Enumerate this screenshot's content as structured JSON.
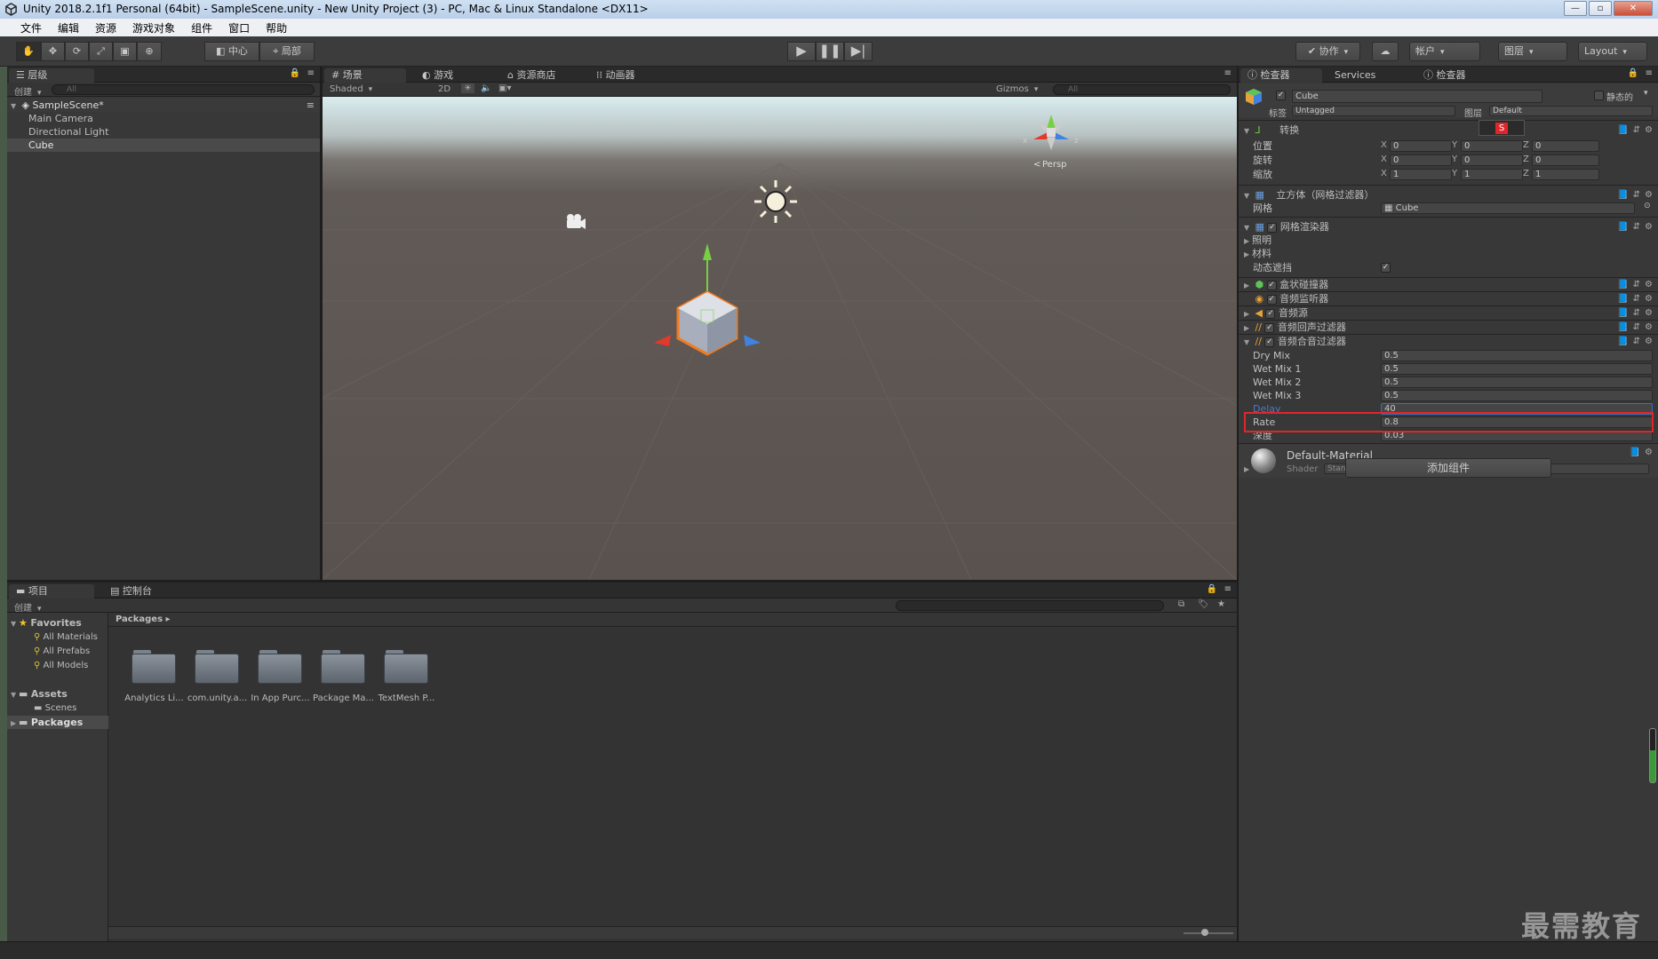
{
  "window": {
    "title": "Unity 2018.2.1f1 Personal (64bit) - SampleScene.unity - New Unity Project (3) - PC, Mac & Linux Standalone <DX11>"
  },
  "menu": [
    "文件",
    "编辑",
    "资源",
    "游戏对象",
    "组件",
    "窗口",
    "帮助"
  ],
  "toolbar": {
    "pivot": "中心",
    "space": "局部",
    "collab": "协作",
    "account": "帐户",
    "layers": "图层",
    "layout": "Layout"
  },
  "hierarchy": {
    "tab": "层级",
    "create": "创建",
    "search_placeholder": "All",
    "scene": "SampleScene*",
    "items": [
      "Main Camera",
      "Directional Light",
      "Cube"
    ]
  },
  "scene": {
    "tabs": [
      "场景",
      "游戏",
      "资源商店",
      "动画器"
    ],
    "shading": "Shaded",
    "mode2d": "2D",
    "gizmos": "Gizmos",
    "search_placeholder": "All",
    "persp": "Persp",
    "gizmo_x": "x",
    "gizmo_z": "z"
  },
  "project": {
    "tabs": [
      "项目",
      "控制台"
    ],
    "create": "创建",
    "favorites": "Favorites",
    "fav_items": [
      "All Materials",
      "All Prefabs",
      "All Models"
    ],
    "assets": "Assets",
    "scenes": "Scenes",
    "packages": "Packages",
    "breadcrumb": "Packages",
    "folders": [
      "Analytics Li...",
      "com.unity.a...",
      "In App Purc...",
      "Package Ma...",
      "TextMesh P..."
    ]
  },
  "inspector": {
    "tabs": [
      "检查器",
      "Services",
      "检查器"
    ],
    "object_name": "Cube",
    "static_label": "静态的",
    "tag_label": "标签",
    "tag_value": "Untagged",
    "layer_label": "图层",
    "layer_value": "Default",
    "transform": {
      "title": "转换",
      "rows": [
        {
          "label": "位置",
          "x": "0",
          "y": "0",
          "z": "0"
        },
        {
          "label": "旋转",
          "x": "0",
          "y": "0",
          "z": "0"
        },
        {
          "label": "缩放",
          "x": "1",
          "y": "1",
          "z": "1"
        }
      ]
    },
    "mesh_filter": {
      "title": "立方体（网格过滤器）",
      "mesh_label": "网格",
      "mesh_value": "Cube"
    },
    "mesh_renderer": {
      "title": "网格渲染器",
      "lighting": "照明",
      "materials": "材料",
      "dynamic_occlusion": "动态遮挡"
    },
    "components": [
      "盒状碰撞器",
      "音频监听器",
      "音频源",
      "音频回声过滤器",
      "音频合音过滤器"
    ],
    "chorus": {
      "rows": [
        {
          "label": "Dry Mix",
          "value": "0.5"
        },
        {
          "label": "Wet Mix 1",
          "value": "0.5"
        },
        {
          "label": "Wet Mix 2",
          "value": "0.5"
        },
        {
          "label": "Wet Mix 3",
          "value": "0.5"
        },
        {
          "label": "Delay",
          "value": "40"
        },
        {
          "label": "Rate",
          "value": "0.8"
        },
        {
          "label": "深度",
          "value": "0.03"
        }
      ]
    },
    "material": {
      "name": "Default-Material",
      "shader_label": "Shader",
      "shader_value": "Standard"
    },
    "add_component": "添加组件"
  },
  "watermark": "最需教育",
  "colors": {
    "accent_red": "#e0262b",
    "selection_blue": "#3d6fb4",
    "gizmo_y": "#77d042",
    "gizmo_x": "#e2392b",
    "gizmo_z": "#3f82e0",
    "cube_outline": "#f07a20"
  }
}
